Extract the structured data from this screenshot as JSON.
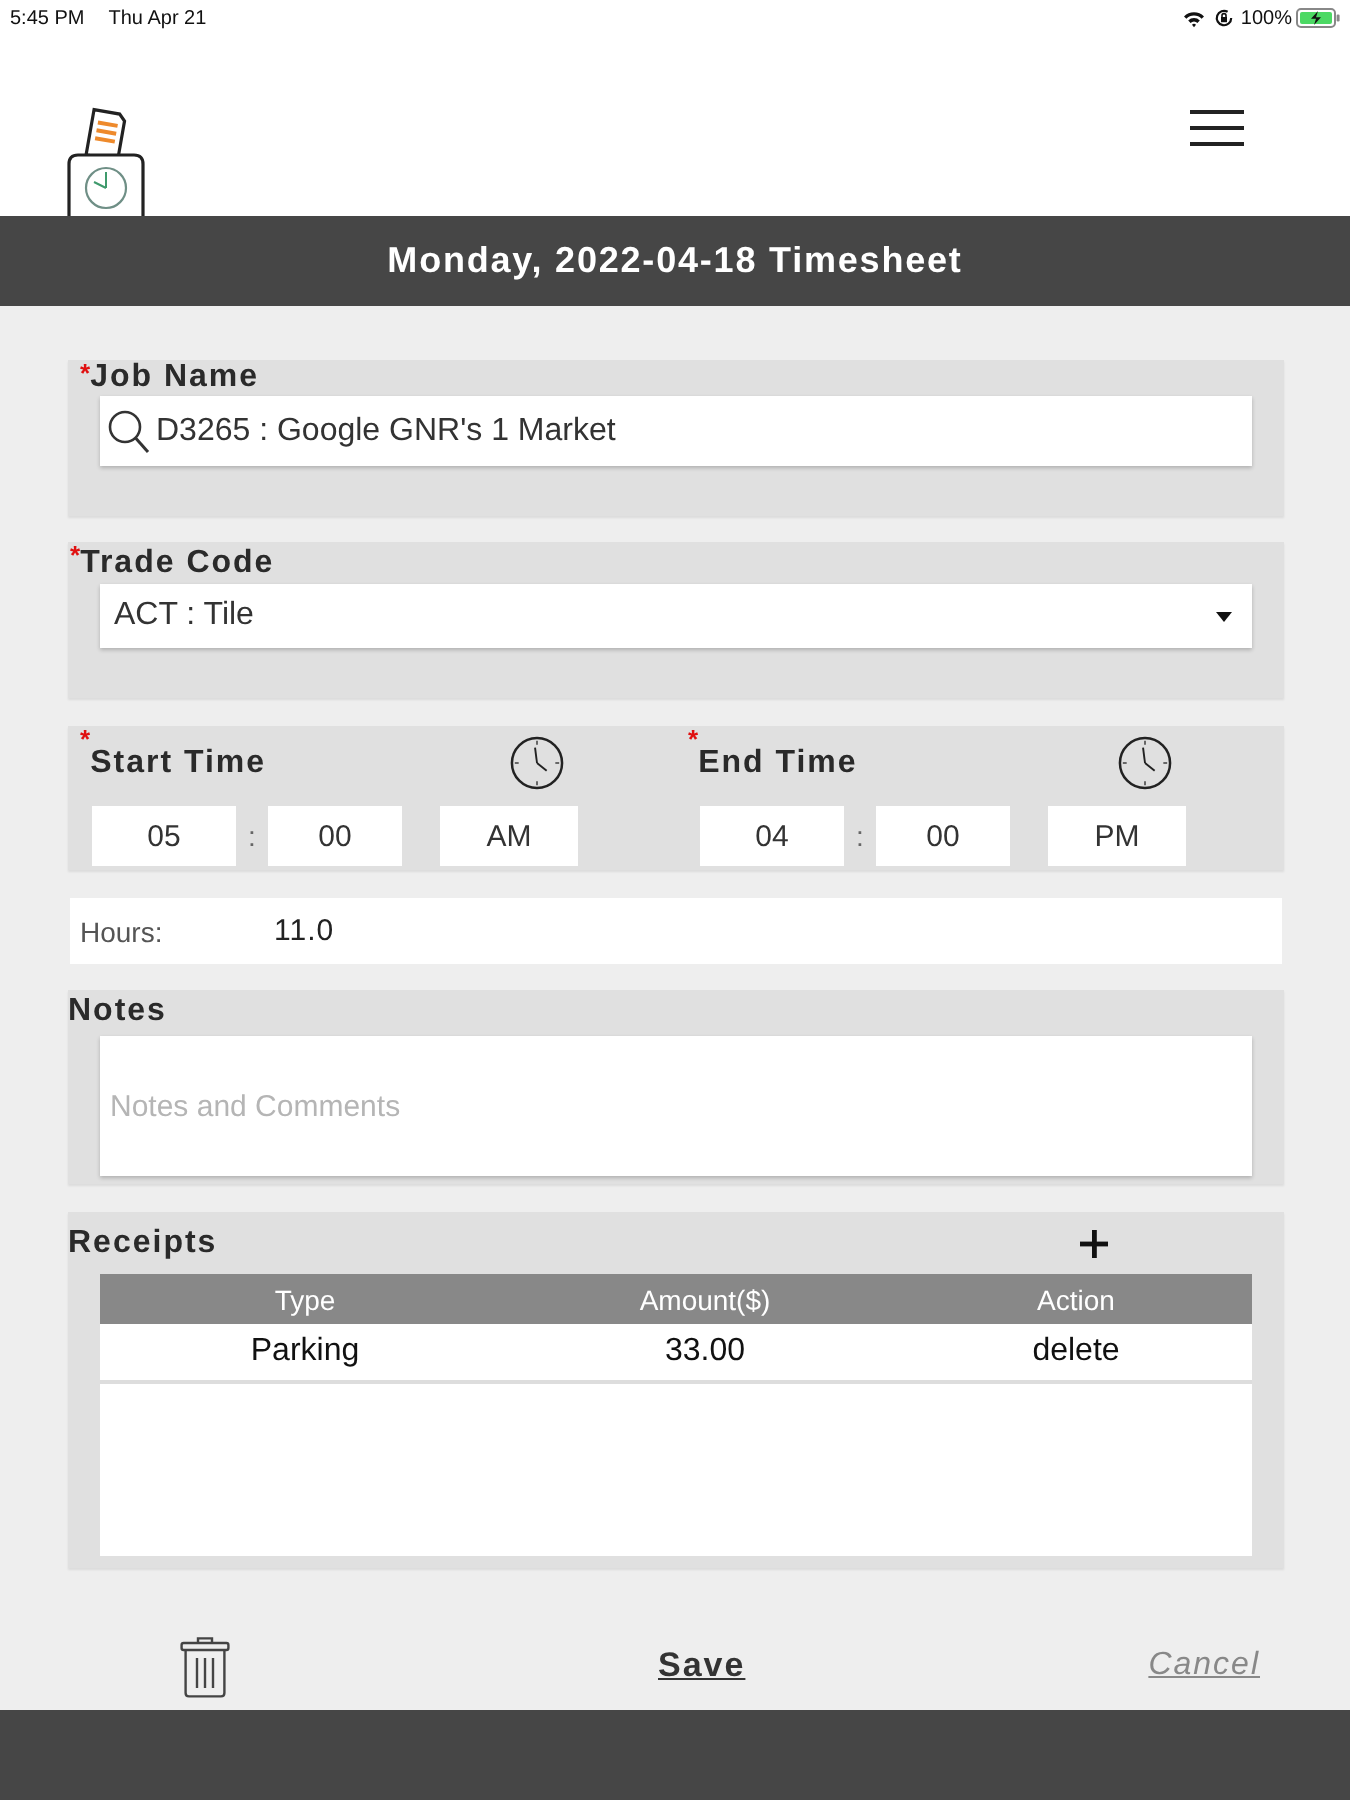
{
  "status_bar": {
    "time": "5:45 PM",
    "date": "Thu Apr 21",
    "battery": "100%"
  },
  "title": "Monday, 2022-04-18 Timesheet",
  "job_name": {
    "required_mark": "*",
    "label": "Job Name",
    "value": "D3265 : Google GNR's 1 Market"
  },
  "trade_code": {
    "required_mark": "*",
    "label": "Trade Code",
    "value": "ACT : Tile"
  },
  "times": [
    {
      "required_mark": "*",
      "label": "Start Time",
      "hour": "05",
      "separator": ":",
      "minute": "00",
      "period": "AM"
    },
    {
      "required_mark": "*",
      "label": "End Time",
      "hour": "04",
      "separator": ":",
      "minute": "00",
      "period": "PM"
    }
  ],
  "hours": {
    "label": "Hours:",
    "value": "11.0"
  },
  "notes": {
    "label": "Notes",
    "placeholder": "Notes and Comments"
  },
  "receipts": {
    "label": "Receipts",
    "columns": [
      "Type",
      "Amount($)",
      "Action"
    ],
    "rows": [
      {
        "type": "Parking",
        "amount": "33.00",
        "action": "delete"
      }
    ]
  },
  "actions": {
    "save": "Save",
    "cancel": "Cancel"
  }
}
